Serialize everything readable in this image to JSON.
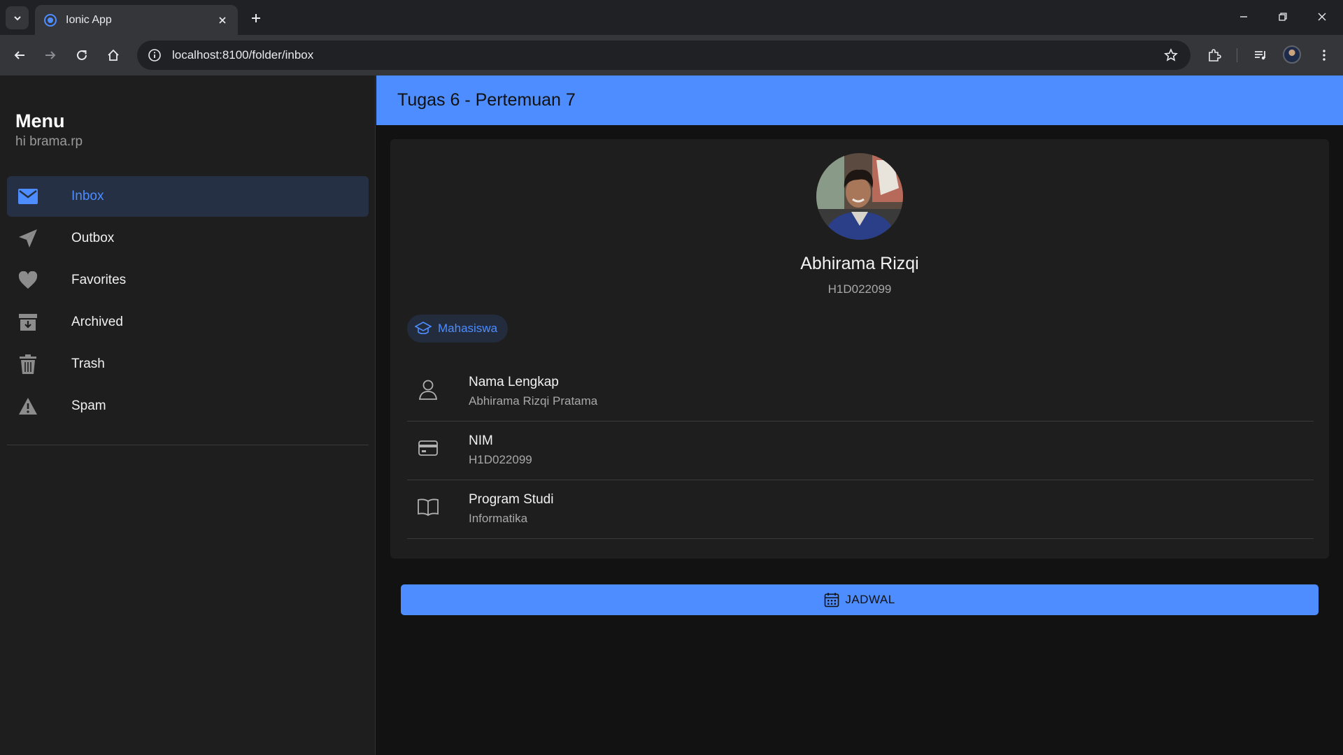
{
  "browser": {
    "tab_title": "Ionic App",
    "url": "localhost:8100/folder/inbox"
  },
  "menu": {
    "title": "Menu",
    "subtitle": "hi brama.rp",
    "items": [
      {
        "label": "Inbox",
        "icon": "mail-icon",
        "active": true
      },
      {
        "label": "Outbox",
        "icon": "paper-plane-icon"
      },
      {
        "label": "Favorites",
        "icon": "heart-icon"
      },
      {
        "label": "Archived",
        "icon": "archive-icon"
      },
      {
        "label": "Trash",
        "icon": "trash-icon"
      },
      {
        "label": "Spam",
        "icon": "warning-icon"
      }
    ]
  },
  "header": {
    "title": "Tugas 6 - Pertemuan 7"
  },
  "profile": {
    "name": "Abhirama Rizqi",
    "nim": "H1D022099",
    "chip_label": "Mahasiswa",
    "details": [
      {
        "title": "Nama Lengkap",
        "value": "Abhirama Rizqi Pratama",
        "icon": "person-icon"
      },
      {
        "title": "NIM",
        "value": "H1D022099",
        "icon": "card-icon"
      },
      {
        "title": "Program Studi",
        "value": "Informatika",
        "icon": "book-icon"
      }
    ]
  },
  "action": {
    "label": "JADWAL",
    "icon": "calendar-icon"
  },
  "colors": {
    "accent": "#4d8dff",
    "background": "#121212",
    "surface": "#1e1e1e"
  }
}
